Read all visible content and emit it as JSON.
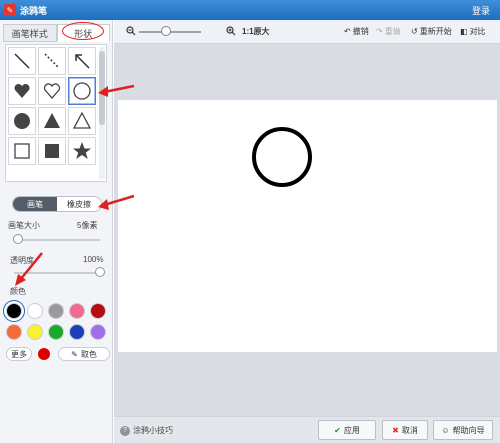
{
  "window": {
    "title": "涂鸦笔",
    "login_label": "登录"
  },
  "left": {
    "tabs": [
      {
        "label": "画笔样式"
      },
      {
        "label": "形状"
      }
    ],
    "shapes": [
      "line-icon",
      "dotted-line-icon",
      "arrow-line-icon",
      "heart-filled-icon",
      "heart-outline-icon",
      "circle-outline-icon",
      "circle-filled-icon",
      "triangle-filled-icon",
      "triangle-outline-icon",
      "square-outline-icon",
      "square-filled-icon",
      "star-filled-icon"
    ],
    "toggle": {
      "brush": "画笔",
      "eraser": "橡皮擦"
    },
    "brush_size_label": "画笔大小",
    "brush_size_value": "5像素",
    "brush_size_fraction": 0.05,
    "opacity_label": "透明度",
    "opacity_value": "100%",
    "opacity_fraction": 1.0,
    "color_label": "颜色",
    "colors": [
      "#000000",
      "#ffffff",
      "#9a9a9a",
      "#f06b8d",
      "#b60b12",
      "#f26b3a",
      "#f8f12d",
      "#17a82c",
      "#1b3fb8",
      "#a070e8"
    ],
    "more_label": "更多",
    "current_color": "#e00000",
    "pick_label": "取色"
  },
  "toolbar": {
    "zoom_label": "1:1原大",
    "undo": "撤销",
    "redo": "重做",
    "restart": "重新开始",
    "compare": "对比"
  },
  "bottom": {
    "tips": "涂鸦小技巧",
    "apply": "应用",
    "cancel": "取消",
    "help": "帮助向导"
  }
}
